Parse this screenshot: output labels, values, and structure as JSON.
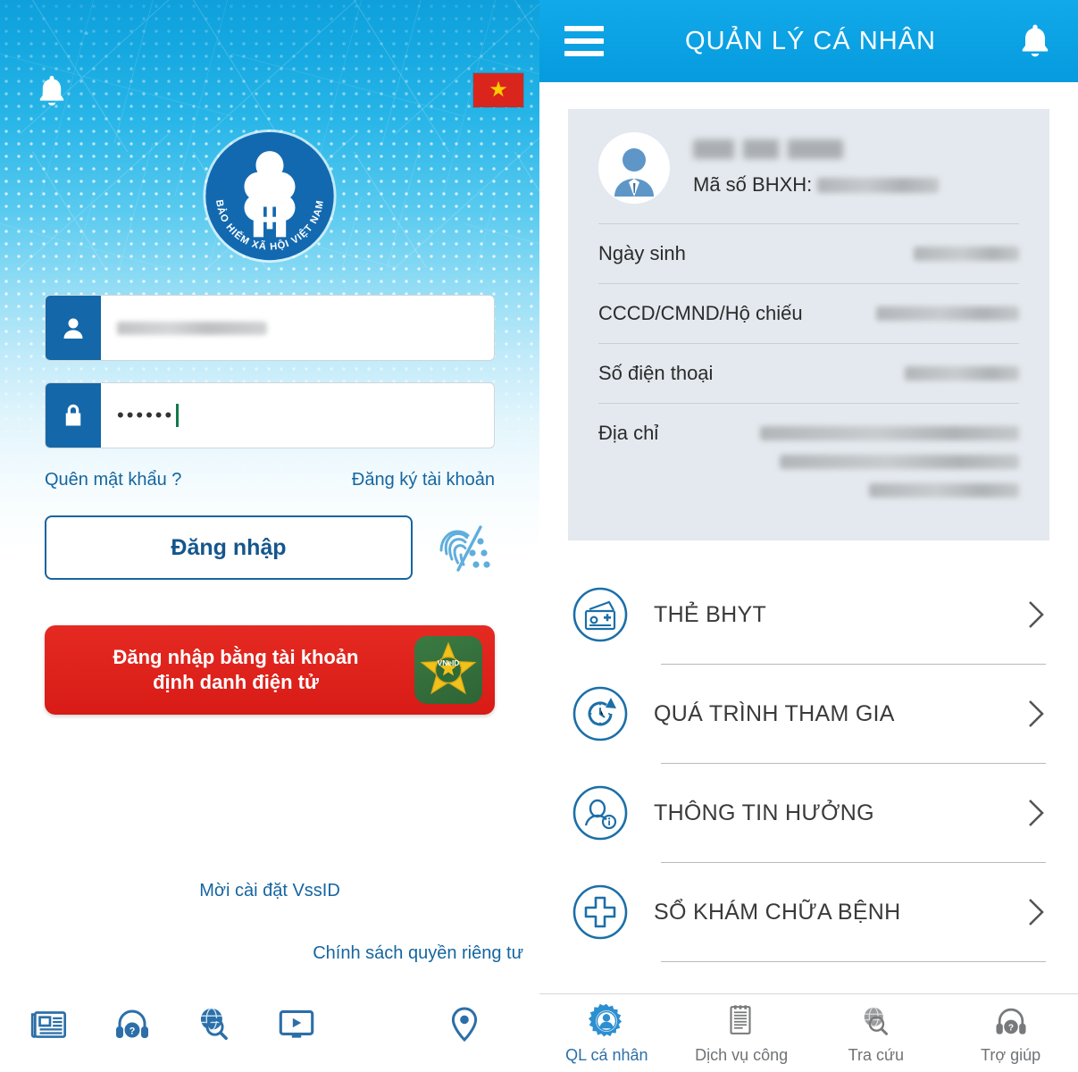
{
  "login": {
    "bell_icon": "bell-icon",
    "flag_icon": "vietnam-flag-icon",
    "flag_star": "★",
    "logo": {
      "name": "vss-logo",
      "circular_text": "BẢO HIỂM XÃ HỘI VIỆT NAM"
    },
    "username_field": {
      "icon": "user-icon",
      "value_redacted": true
    },
    "password_field": {
      "icon": "lock-icon",
      "value": "••••••",
      "caret_color": "#117a4b"
    },
    "forgot_password": "Quên mật khẩu ?",
    "register": "Đăng ký tài khoản",
    "signin_button": "Đăng nhập",
    "fingerprint_icon": "fingerprint-icon",
    "vneid_button": {
      "line1": "Đăng nhập bằng tài khoản",
      "line2": "định danh điện tử",
      "badge_text": "VNeID",
      "bg_color": "#E52A22"
    },
    "install_link": "Mời cài đặt VssID",
    "privacy_link": "Chính sách quyền riêng tư",
    "toolbar": [
      {
        "icon": "newspaper-icon"
      },
      {
        "icon": "headset-help-icon"
      },
      {
        "icon": "globe-search-icon"
      },
      {
        "icon": "video-player-icon"
      },
      {
        "icon": "location-pin-icon"
      }
    ]
  },
  "profile": {
    "header": {
      "menu_icon": "hamburger-icon",
      "title": "QUẢN LÝ CÁ NHÂN",
      "bell_icon": "bell-icon",
      "bg_color": "#0FA6E8"
    },
    "card": {
      "avatar_icon": "avatar-person-icon",
      "name_redacted": true,
      "bhxh_label": "Mã số BHXH:",
      "bhxh_value_redacted": true,
      "rows": [
        {
          "label": "Ngày sinh",
          "value_redacted": true,
          "value_width": 118
        },
        {
          "label": "CCCD/CMND/Hộ chiếu",
          "value_redacted": true,
          "value_width": 160
        },
        {
          "label": "Số điện thoại",
          "value_redacted": true,
          "value_width": 128
        }
      ],
      "address_label": "Địa chỉ",
      "address_lines_widths": [
        290,
        268,
        168
      ]
    },
    "menu": [
      {
        "label": "THẺ BHYT",
        "icon": "health-card-icon"
      },
      {
        "label": "QUÁ TRÌNH THAM GIA",
        "icon": "clock-refresh-icon"
      },
      {
        "label": "THÔNG TIN HƯỞNG",
        "icon": "person-info-icon"
      },
      {
        "label": "SỔ KHÁM CHỮA BỆNH",
        "icon": "medical-cross-icon"
      }
    ],
    "tabs": [
      {
        "label": "QL cá nhân",
        "icon": "gear-person-icon",
        "active": true
      },
      {
        "label": "Dịch vụ công",
        "icon": "document-icon",
        "active": false
      },
      {
        "label": "Tra cứu",
        "icon": "globe-search-icon",
        "active": false
      },
      {
        "label": "Trợ giúp",
        "icon": "headset-help-icon",
        "active": false
      }
    ]
  }
}
